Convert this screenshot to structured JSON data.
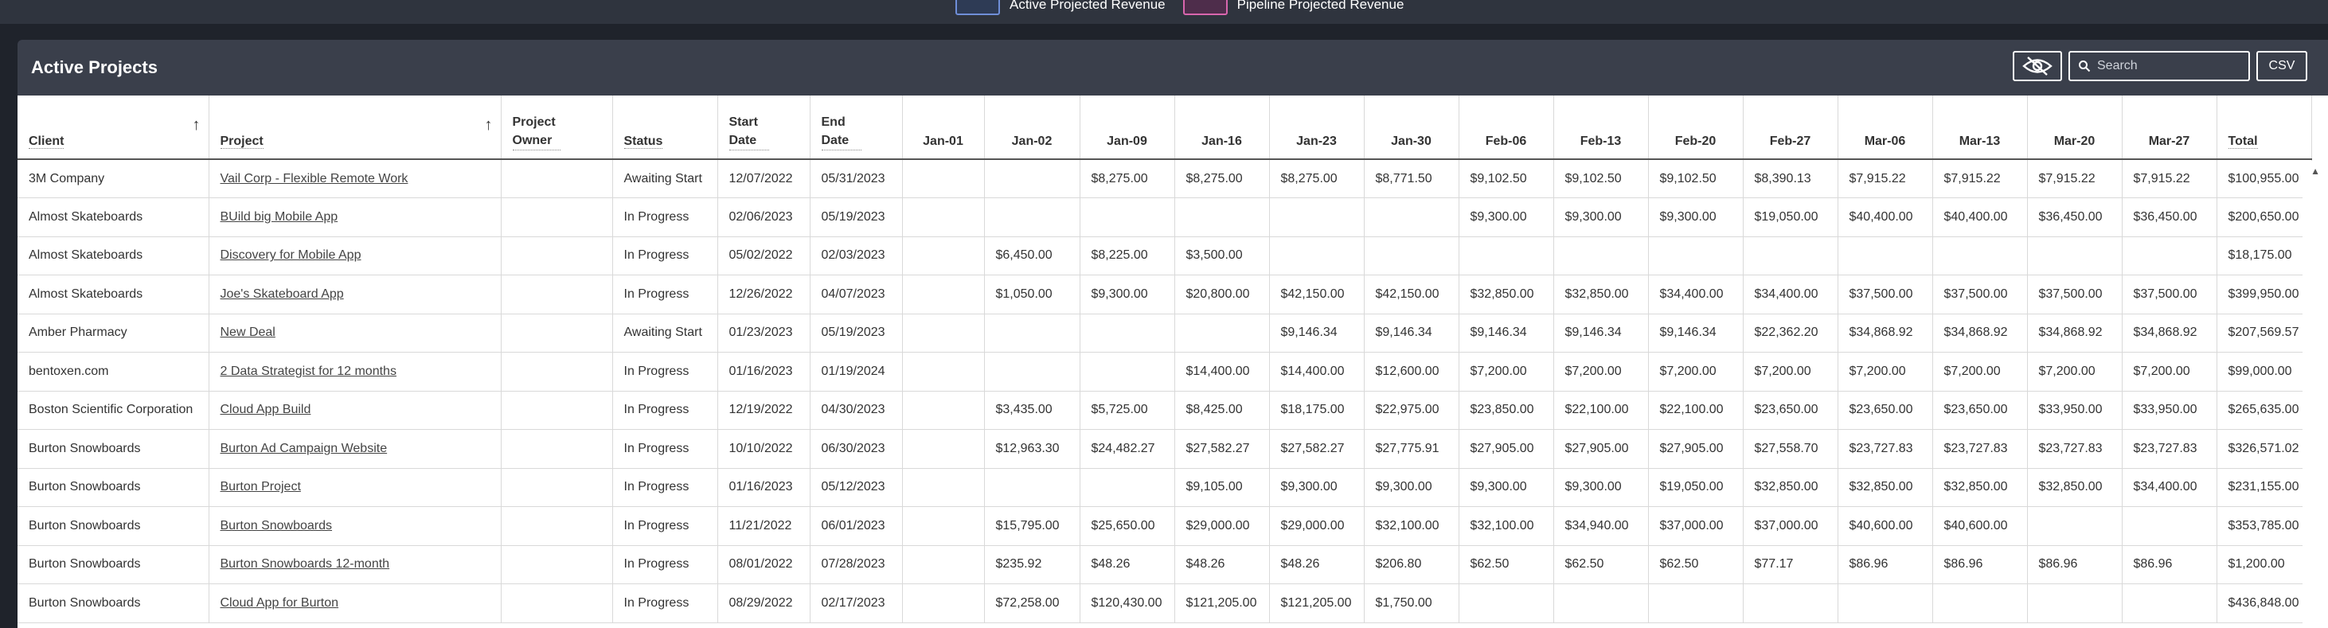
{
  "legend": {
    "items": [
      {
        "label": "Active Projected Revenue",
        "color": "#6f8ed8"
      },
      {
        "label": "Pipeline Projected Revenue",
        "color": "#d866ad"
      }
    ]
  },
  "panel": {
    "title": "Active Projects",
    "search_placeholder": "Search",
    "csv_label": "CSV"
  },
  "table": {
    "columns": [
      {
        "label": "Client",
        "sort": "up"
      },
      {
        "label": "Project",
        "sort": "up"
      },
      {
        "label": "Project Owner"
      },
      {
        "label": "Status"
      },
      {
        "label": "Start Date"
      },
      {
        "label": "End Date"
      },
      {
        "label": "Jan-01"
      },
      {
        "label": "Jan-02"
      },
      {
        "label": "Jan-09"
      },
      {
        "label": "Jan-16"
      },
      {
        "label": "Jan-23"
      },
      {
        "label": "Jan-30"
      },
      {
        "label": "Feb-06"
      },
      {
        "label": "Feb-13"
      },
      {
        "label": "Feb-20"
      },
      {
        "label": "Feb-27"
      },
      {
        "label": "Mar-06"
      },
      {
        "label": "Mar-13"
      },
      {
        "label": "Mar-20"
      },
      {
        "label": "Mar-27"
      },
      {
        "label": "Total"
      }
    ],
    "rows": [
      [
        "3M Company",
        "Vail Corp - Flexible Remote Work",
        "",
        "Awaiting Start",
        "12/07/2022",
        "05/31/2023",
        "",
        "",
        "$8,275.00",
        "$8,275.00",
        "$8,275.00",
        "$8,771.50",
        "$9,102.50",
        "$9,102.50",
        "$9,102.50",
        "$8,390.13",
        "$7,915.22",
        "$7,915.22",
        "$7,915.22",
        "$7,915.22",
        "$100,955.00"
      ],
      [
        "Almost Skateboards",
        "BUild big Mobile App",
        "",
        "In Progress",
        "02/06/2023",
        "05/19/2023",
        "",
        "",
        "",
        "",
        "",
        "",
        "$9,300.00",
        "$9,300.00",
        "$9,300.00",
        "$19,050.00",
        "$40,400.00",
        "$40,400.00",
        "$36,450.00",
        "$36,450.00",
        "$200,650.00"
      ],
      [
        "Almost Skateboards",
        "Discovery for Mobile App",
        "",
        "In Progress",
        "05/02/2022",
        "02/03/2023",
        "",
        "$6,450.00",
        "$8,225.00",
        "$3,500.00",
        "",
        "",
        "",
        "",
        "",
        "",
        "",
        "",
        "",
        "",
        "$18,175.00"
      ],
      [
        "Almost Skateboards",
        "Joe's Skateboard App",
        "",
        "In Progress",
        "12/26/2022",
        "04/07/2023",
        "",
        "$1,050.00",
        "$9,300.00",
        "$20,800.00",
        "$42,150.00",
        "$42,150.00",
        "$32,850.00",
        "$32,850.00",
        "$34,400.00",
        "$34,400.00",
        "$37,500.00",
        "$37,500.00",
        "$37,500.00",
        "$37,500.00",
        "$399,950.00"
      ],
      [
        "Amber Pharmacy",
        "New Deal",
        "",
        "Awaiting Start",
        "01/23/2023",
        "05/19/2023",
        "",
        "",
        "",
        "",
        "$9,146.34",
        "$9,146.34",
        "$9,146.34",
        "$9,146.34",
        "$9,146.34",
        "$22,362.20",
        "$34,868.92",
        "$34,868.92",
        "$34,868.92",
        "$34,868.92",
        "$207,569.57"
      ],
      [
        "bentoxen.com",
        "2 Data Strategist for 12 months",
        "",
        "In Progress",
        "01/16/2023",
        "01/19/2024",
        "",
        "",
        "",
        "$14,400.00",
        "$14,400.00",
        "$12,600.00",
        "$7,200.00",
        "$7,200.00",
        "$7,200.00",
        "$7,200.00",
        "$7,200.00",
        "$7,200.00",
        "$7,200.00",
        "$7,200.00",
        "$99,000.00"
      ],
      [
        "Boston Scientific Corporation",
        "Cloud App Build",
        "",
        "In Progress",
        "12/19/2022",
        "04/30/2023",
        "",
        "$3,435.00",
        "$5,725.00",
        "$8,425.00",
        "$18,175.00",
        "$22,975.00",
        "$23,850.00",
        "$22,100.00",
        "$22,100.00",
        "$23,650.00",
        "$23,650.00",
        "$23,650.00",
        "$33,950.00",
        "$33,950.00",
        "$265,635.00"
      ],
      [
        "Burton Snowboards",
        "Burton Ad Campaign Website",
        "",
        "In Progress",
        "10/10/2022",
        "06/30/2023",
        "",
        "$12,963.30",
        "$24,482.27",
        "$27,582.27",
        "$27,582.27",
        "$27,775.91",
        "$27,905.00",
        "$27,905.00",
        "$27,905.00",
        "$27,558.70",
        "$23,727.83",
        "$23,727.83",
        "$23,727.83",
        "$23,727.83",
        "$326,571.02"
      ],
      [
        "Burton Snowboards",
        "Burton Project",
        "",
        "In Progress",
        "01/16/2023",
        "05/12/2023",
        "",
        "",
        "",
        "$9,105.00",
        "$9,300.00",
        "$9,300.00",
        "$9,300.00",
        "$9,300.00",
        "$19,050.00",
        "$32,850.00",
        "$32,850.00",
        "$32,850.00",
        "$32,850.00",
        "$34,400.00",
        "$231,155.00"
      ],
      [
        "Burton Snowboards",
        "Burton Snowboards",
        "",
        "In Progress",
        "11/21/2022",
        "06/01/2023",
        "",
        "$15,795.00",
        "$25,650.00",
        "$29,000.00",
        "$29,000.00",
        "$32,100.00",
        "$32,100.00",
        "$34,940.00",
        "$37,000.00",
        "$37,000.00",
        "$40,600.00",
        "$40,600.00",
        "",
        "",
        "$353,785.00"
      ],
      [
        "Burton Snowboards",
        "Burton Snowboards 12-month",
        "",
        "In Progress",
        "08/01/2022",
        "07/28/2023",
        "",
        "$235.92",
        "$48.26",
        "$48.26",
        "$48.26",
        "$206.80",
        "$62.50",
        "$62.50",
        "$62.50",
        "$77.17",
        "$86.96",
        "$86.96",
        "$86.96",
        "$86.96",
        "$1,200.00"
      ],
      [
        "Burton Snowboards",
        "Cloud App for Burton",
        "",
        "In Progress",
        "08/29/2022",
        "02/17/2023",
        "",
        "$72,258.00",
        "$120,430.00",
        "$121,205.00",
        "$121,205.00",
        "$1,750.00",
        "",
        "",
        "",
        "",
        "",
        "",
        "",
        "",
        "$436,848.00"
      ]
    ]
  }
}
